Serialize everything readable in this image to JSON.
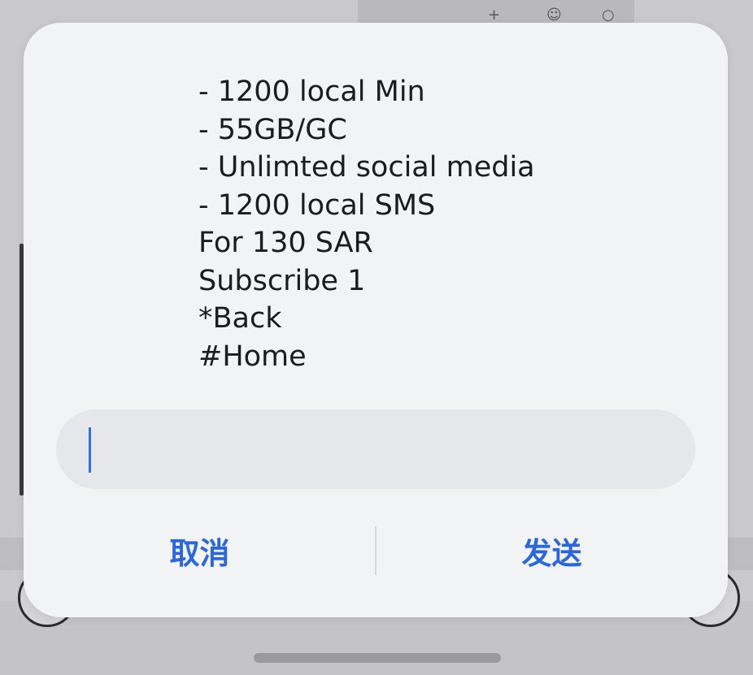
{
  "dialog": {
    "message_lines": [
      "- 1200 local Min",
      "- 55GB/GC",
      "- Unlimted social media",
      "- 1200 local SMS",
      "For 130 SAR",
      "Subscribe 1",
      "*Back",
      "#Home"
    ],
    "input": {
      "value": "",
      "caret_color": "#2f6fe8"
    },
    "cancel_label": "取消",
    "send_label": "发送",
    "accent_color": "#2a66e0"
  },
  "background": {
    "icons": [
      "plus-icon",
      "person-icon",
      "circle-icon"
    ]
  }
}
